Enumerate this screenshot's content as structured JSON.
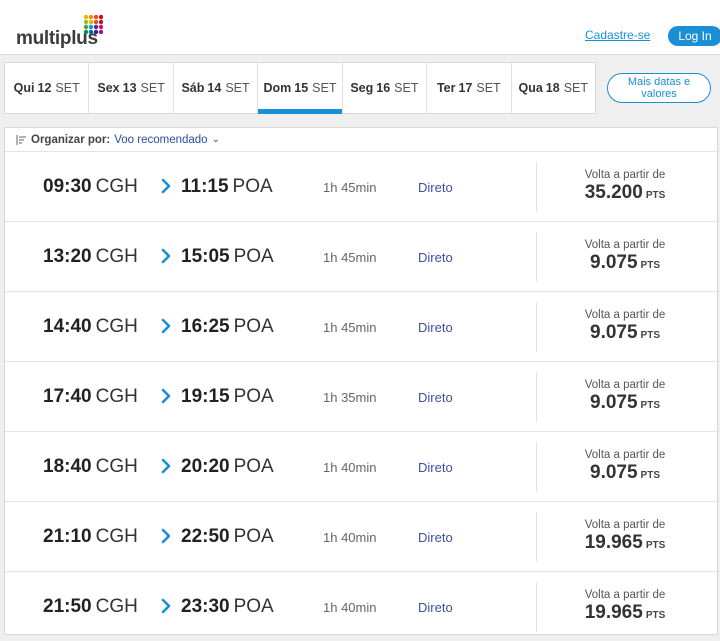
{
  "header": {
    "logo_text": "multiplus",
    "signup_label": "Cadastre-se",
    "login_label": "Log In"
  },
  "date_tabs": [
    {
      "dow": "Qui",
      "day": "12",
      "month": "SET",
      "active": false
    },
    {
      "dow": "Sex",
      "day": "13",
      "month": "SET",
      "active": false
    },
    {
      "dow": "Sáb",
      "day": "14",
      "month": "SET",
      "active": false
    },
    {
      "dow": "Dom",
      "day": "15",
      "month": "SET",
      "active": true
    },
    {
      "dow": "Seg",
      "day": "16",
      "month": "SET",
      "active": false
    },
    {
      "dow": "Ter",
      "day": "17",
      "month": "SET",
      "active": false
    },
    {
      "dow": "Qua",
      "day": "18",
      "month": "SET",
      "active": false
    }
  ],
  "more_dates": {
    "line1": "Mais datas e",
    "line2": "valores"
  },
  "sort": {
    "label": "Organizar por:",
    "value": "Voo recomendado"
  },
  "flights": [
    {
      "dep_time": "09:30",
      "dep_code": "CGH",
      "arr_time": "11:15",
      "arr_code": "POA",
      "duration": "1h 45min",
      "type": "Direto",
      "price_label": "Volta a partir de",
      "price": "35.200",
      "unit": "PTS"
    },
    {
      "dep_time": "13:20",
      "dep_code": "CGH",
      "arr_time": "15:05",
      "arr_code": "POA",
      "duration": "1h 45min",
      "type": "Direto",
      "price_label": "Volta a partir de",
      "price": "9.075",
      "unit": "PTS"
    },
    {
      "dep_time": "14:40",
      "dep_code": "CGH",
      "arr_time": "16:25",
      "arr_code": "POA",
      "duration": "1h 45min",
      "type": "Direto",
      "price_label": "Volta a partir de",
      "price": "9.075",
      "unit": "PTS"
    },
    {
      "dep_time": "17:40",
      "dep_code": "CGH",
      "arr_time": "19:15",
      "arr_code": "POA",
      "duration": "1h 35min",
      "type": "Direto",
      "price_label": "Volta a partir de",
      "price": "9.075",
      "unit": "PTS"
    },
    {
      "dep_time": "18:40",
      "dep_code": "CGH",
      "arr_time": "20:20",
      "arr_code": "POA",
      "duration": "1h 40min",
      "type": "Direto",
      "price_label": "Volta a partir de",
      "price": "9.075",
      "unit": "PTS"
    },
    {
      "dep_time": "21:10",
      "dep_code": "CGH",
      "arr_time": "22:50",
      "arr_code": "POA",
      "duration": "1h 40min",
      "type": "Direto",
      "price_label": "Volta a partir de",
      "price": "19.965",
      "unit": "PTS"
    },
    {
      "dep_time": "21:50",
      "dep_code": "CGH",
      "arr_time": "23:30",
      "arr_code": "POA",
      "duration": "1h 40min",
      "type": "Direto",
      "price_label": "Volta a partir de",
      "price": "19.965",
      "unit": "PTS"
    }
  ],
  "colors": {
    "accent": "#1a8fd6",
    "link": "#3f4fa5"
  },
  "icons": {
    "logo": "multiplus-dots-logo",
    "sort": "sort-lines-icon",
    "arrow": "chevron-right-icon"
  }
}
